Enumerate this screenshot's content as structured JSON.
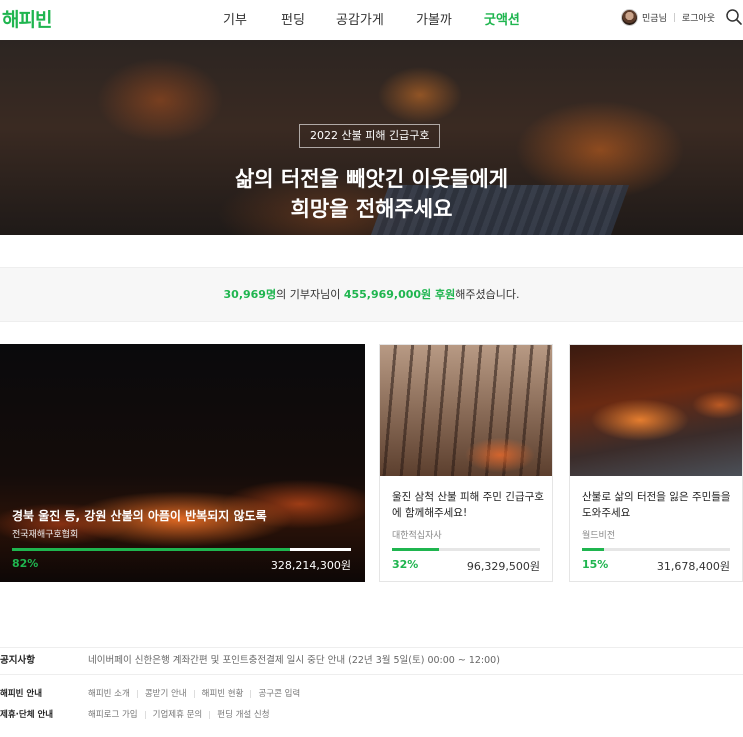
{
  "header": {
    "logo": "해피빈",
    "nav": [
      "기부",
      "펀딩",
      "공감가게",
      "가볼까",
      "굿액션"
    ],
    "active_nav": "굿액션",
    "user_name": "민금님",
    "logout": "로그아웃"
  },
  "hero": {
    "badge": "2022 산불 피해 긴급구호",
    "title_line1": "삶의 터전을 빼앗긴 이웃들에게",
    "title_line2": "희망을 전해주세요"
  },
  "stats": {
    "donors": "30,969명",
    "text1": "의 기부자님이 ",
    "amount": "455,969,000원 후원",
    "text2": "해주셨습니다."
  },
  "cards": [
    {
      "title": "경북 울진 등, 강원 산불의 아픔이 반복되지 않도록",
      "org": "전국재해구호협회",
      "percent": "82%",
      "progress": 0.82,
      "amount": "328,214,300원"
    },
    {
      "title": "울진 삼척 산불 피해 주민 긴급구호에 함께해주세요!",
      "org": "대한적십자사",
      "percent": "32%",
      "progress": 0.32,
      "amount": "96,329,500원"
    },
    {
      "title": "산불로 삶의 터전을 잃은 주민들을 도와주세요",
      "org": "월드비전",
      "percent": "15%",
      "progress": 0.15,
      "amount": "31,678,400원"
    }
  ],
  "notice": {
    "label": "공지사항",
    "text": "네이버페이 신한은행 계좌간편 및 포인트충전결제 일시 중단 안내 (22년 3월 5일(토) 00:00 ~ 12:00)"
  },
  "footer": {
    "row1_label": "해피빈 안내",
    "row1_links": [
      "해피빈 소개",
      "콩받기 안내",
      "해피빈 현황",
      "공구콘 입력"
    ],
    "row2_label": "제휴·단체 안내",
    "row2_links": [
      "해피로그 가입",
      "기업제휴 문의",
      "펀딩 개설 신청"
    ]
  },
  "colors": {
    "brand": "#1fb54f"
  }
}
